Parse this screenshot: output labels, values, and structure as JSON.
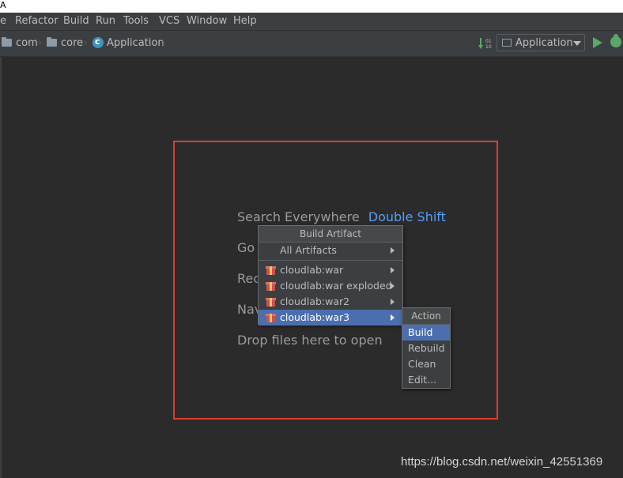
{
  "title_fragment": "A",
  "menu": [
    "e",
    "Refactor",
    "Build",
    "Run",
    "Tools",
    "VCS",
    "Window",
    "Help"
  ],
  "breadcrumb": [
    "com",
    "core",
    "Application"
  ],
  "run_config": {
    "label": "Application"
  },
  "hints": {
    "search_label": "Search Everywhere",
    "search_key": "Double Shift",
    "goto_fragment": "Go",
    "recent_fragment": "Rec",
    "nav_fragment": "Nav",
    "drop": "Drop files here to open"
  },
  "build_artifact_popup": {
    "title": "Build Artifact",
    "items": [
      "All Artifacts",
      "cloudlab:war",
      "cloudlab:war exploded",
      "cloudlab:war2",
      "cloudlab:war3"
    ],
    "selected": "cloudlab:war3"
  },
  "action_popup": {
    "title": "Action",
    "items": [
      "Build",
      "Rebuild",
      "Clean",
      "Edit..."
    ],
    "selected": "Build"
  },
  "watermark": "https://blog.csdn.net/weixin_42551369",
  "colors": {
    "highlight_frame": "#e23b2f",
    "selection": "#4b6eaf",
    "shortcut": "#589df6",
    "run": "#59a869"
  }
}
